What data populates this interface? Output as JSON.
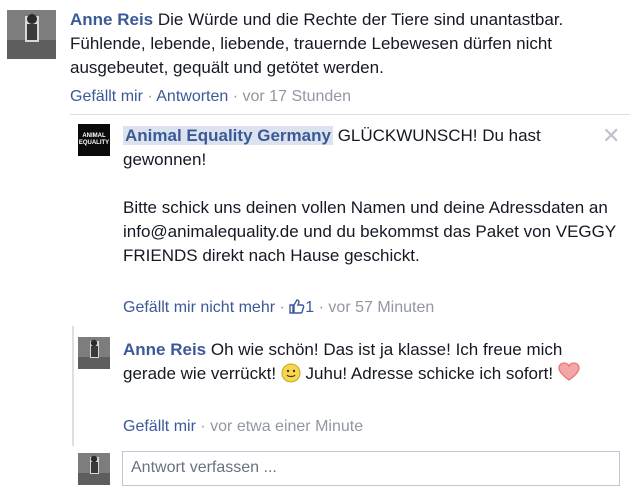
{
  "comment1": {
    "author": "Anne Reis",
    "text": "Die Würde und die Rechte der Tiere sind unantastbar. Fühlende, lebende, liebende, trauernde Lebewesen dürfen nicht ausgebeutet, gequält und getötet werden.",
    "like_label": "Gefällt mir",
    "reply_label": "Antworten",
    "timestamp": "vor 17 Stunden"
  },
  "reply1": {
    "author": "Animal Equality Germany",
    "logo_text": "ANIMAL EQUALITY",
    "text_line1": "GLÜCKWUNSCH! Du hast gewonnen!",
    "text_para2": "Bitte schick uns deinen vollen Namen und deine Adressdaten an info@animalequality.de und du bekommst das Paket von VEGGY FRIENDS direkt nach Hause geschickt.",
    "unlike_label": "Gefällt mir nicht mehr",
    "like_count": "1",
    "timestamp": "vor 57 Minuten",
    "close_symbol": "✕"
  },
  "reply2": {
    "author": "Anne Reis",
    "text_part1": "Oh wie schön! Das ist ja klasse! Ich freue mich gerade wie verrückt!",
    "text_part2": "Juhu! Adresse schicke ich sofort!",
    "like_label": "Gefällt mir",
    "timestamp": "vor etwa einer Minute"
  },
  "composer": {
    "placeholder": "Antwort verfassen ..."
  },
  "icons": {
    "like": "thumbs-up-icon",
    "smile": "smile-emoji-icon",
    "heart": "heart-emoji-icon",
    "close": "close-icon"
  },
  "colors": {
    "link": "#3b5998",
    "meta": "#9197a3",
    "heart": "#e9767a",
    "smile": "#f7d64b"
  }
}
